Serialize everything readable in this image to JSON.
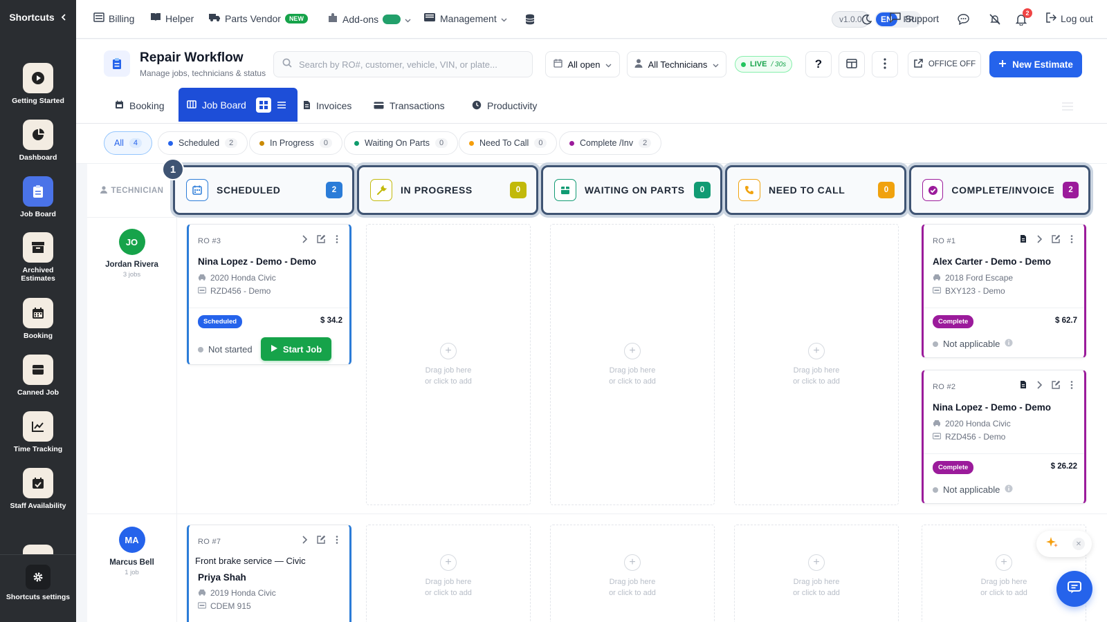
{
  "sidebar": {
    "title": "Shortcuts",
    "items": [
      {
        "label": "Getting Started",
        "icon": "play-icon"
      },
      {
        "label": "Dashboard",
        "icon": "pie-chart-icon"
      },
      {
        "label": "Job Board",
        "icon": "clipboard-icon",
        "active": true
      },
      {
        "label": "Archived Estimates",
        "icon": "archive-icon"
      },
      {
        "label": "Booking",
        "icon": "calendar-icon"
      },
      {
        "label": "Canned Job",
        "icon": "box-icon"
      },
      {
        "label": "Time Tracking",
        "icon": "line-chart-icon"
      },
      {
        "label": "Staff Availability",
        "icon": "calendar-check-icon"
      }
    ],
    "settings_label": "Shortcuts settings"
  },
  "topbar": {
    "billing": "Billing",
    "helper": "Helper",
    "parts_vendor": "Parts Vendor",
    "new_badge": "NEW",
    "addons": "Add-ons",
    "management": "Management",
    "version": "v1.0.0",
    "lang_en": "EN",
    "lang_fr": "FR",
    "support": "Support",
    "notif_count": "2",
    "logout": "Log out"
  },
  "header": {
    "title": "Repair Workflow",
    "subtitle": "Manage jobs, technicians & status",
    "search_placeholder": "Search by RO#, customer, vehicle, VIN, or plate...",
    "filter_open": "All open",
    "filter_tech": "All Technicians",
    "live": "LIVE",
    "live_interval": "/ 30s",
    "help": "?",
    "office": "OFFICE OFF",
    "new_estimate": "New Estimate"
  },
  "tabs": [
    {
      "label": "Booking",
      "icon": "calendar-icon"
    },
    {
      "label": "Job Board",
      "icon": "board-icon",
      "active": true
    },
    {
      "label": "Invoices",
      "icon": "document-icon"
    },
    {
      "label": "Transactions",
      "icon": "card-icon"
    },
    {
      "label": "Productivity",
      "icon": "clock-icon"
    }
  ],
  "filters": [
    {
      "label": "All",
      "count": "4",
      "active": true
    },
    {
      "label": "Scheduled",
      "count": "2",
      "color": "#2563eb"
    },
    {
      "label": "In Progress",
      "count": "0",
      "color": "#ca8a04"
    },
    {
      "label": "Waiting On Parts",
      "count": "0",
      "color": "#0f9b6c"
    },
    {
      "label": "Need To Call",
      "count": "0",
      "color": "#f59e0b"
    },
    {
      "label": "Complete /Inv",
      "count": "2",
      "color": "#9b1b9b"
    }
  ],
  "board": {
    "technician_header": "TECHNICIAN",
    "step": "1",
    "columns": [
      {
        "name": "SCHEDULED",
        "count": "2",
        "color": "#2b7cd8"
      },
      {
        "name": "IN PROGRESS",
        "count": "0",
        "color": "#c2b90a"
      },
      {
        "name": "WAITING ON PARTS",
        "count": "0",
        "color": "#119b73"
      },
      {
        "name": "NEED TO CALL",
        "count": "0",
        "color": "#f0a20e"
      },
      {
        "name": "COMPLETE/INVOICE",
        "count": "2",
        "color": "#9b1b9b"
      }
    ],
    "empty_line1": "Drag job here",
    "empty_line2": "or click to add",
    "technicians": [
      {
        "initials": "JO",
        "name": "Jordan Rivera",
        "jobs": "3 jobs",
        "color": "#16a34a"
      },
      {
        "initials": "MA",
        "name": "Marcus Bell",
        "jobs": "1 job",
        "color": "#2563eb"
      }
    ],
    "cards": {
      "ro3": {
        "ro": "RO #3",
        "customer": "Nina Lopez - Demo - Demo",
        "vehicle": "2020 Honda Civic",
        "plate": "RZD456 - Demo",
        "status": "Scheduled",
        "amount": "$ 34.2",
        "state": "Not started",
        "action": "Start Job"
      },
      "ro1": {
        "ro": "RO #1",
        "customer": "Alex Carter - Demo - Demo",
        "vehicle": "2018 Ford Escape",
        "plate": "BXY123 - Demo",
        "status": "Complete",
        "amount": "$ 62.7",
        "state": "Not applicable"
      },
      "ro2": {
        "ro": "RO #2",
        "customer": "Nina Lopez - Demo - Demo",
        "vehicle": "2020 Honda Civic",
        "plate": "RZD456 - Demo",
        "status": "Complete",
        "amount": "$ 26.22",
        "state": "Not applicable"
      },
      "ro7": {
        "ro": "RO #7",
        "service": "Front brake service — Civic",
        "customer": "Priya Shah",
        "vehicle": "2019 Honda Civic",
        "plate": "CDEM 915"
      }
    }
  },
  "colors": {
    "primary": "#2563eb",
    "sidebar": "#2a2d31",
    "complete": "#9b1b9b",
    "start": "#16a34a"
  }
}
